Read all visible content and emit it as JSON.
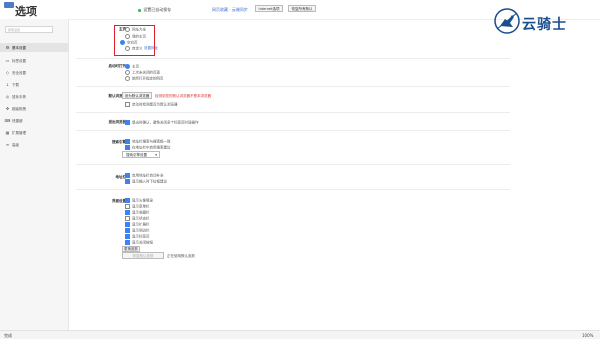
{
  "window": {
    "title": "选项"
  },
  "top": {
    "autosave": "设置已自动保存",
    "notify_link": "网页收藏 · 云端同步",
    "ie_button": "Internet选项",
    "restore_button": "恢复所有默认"
  },
  "sidebar": {
    "search_placeholder": "搜索设置",
    "items": [
      {
        "label": "基本设置",
        "icon": "gear-icon"
      },
      {
        "label": "标签设置",
        "icon": "tab-icon"
      },
      {
        "label": "安全设置",
        "icon": "shield-icon"
      },
      {
        "label": "下载",
        "icon": "download-icon"
      },
      {
        "label": "鼠标手势",
        "icon": "mouse-icon"
      },
      {
        "label": "超级拖拽",
        "icon": "drag-icon"
      },
      {
        "label": "快捷键",
        "icon": "keyboard-icon"
      },
      {
        "label": "扩展管理",
        "icon": "extension-icon"
      },
      {
        "label": "高级",
        "icon": "advanced-icon"
      }
    ]
  },
  "homepage": {
    "label": "主页",
    "options": [
      "网址大全",
      "我的主页",
      "空白页",
      "自定义"
    ],
    "selected": 2,
    "link": "设置网址"
  },
  "startup": {
    "label": "启动时打开",
    "options": [
      "主页",
      "上次未关闭的页面",
      "始终打开指定的网页"
    ],
    "selected": 0
  },
  "default_browser": {
    "label": "默认浏览器",
    "button": "设为默认浏览器",
    "warning": "检测到您的默认浏览器不是本浏览器",
    "check": "启动时检测是否为默认浏览器"
  },
  "session": {
    "label": "退出浏览器",
    "check": "退出时确认，避免关闭多个标签页时误操作"
  },
  "search_engine": {
    "label": "搜索引擎",
    "checks": [
      "地址栏搜索与搜索框一致",
      "在地址栏中启用搜索建议"
    ],
    "select": "搜索引擎设置"
  },
  "address_bar": {
    "label": "地址栏",
    "checks": [
      "启用地址栏自动补全",
      "显示输入时下拉框建议"
    ]
  },
  "appearance": {
    "label": "界面设置",
    "checks": [
      "显示头像登录",
      "显示菜单栏",
      "显示收藏栏",
      "显示状态栏",
      "显示扩展栏",
      "显示侧边栏",
      "显示标签页",
      "显示关闭按钮"
    ],
    "checked": [
      true,
      false,
      true,
      false,
      true,
      true,
      true,
      true
    ],
    "button": "更换皮肤",
    "bottom_button": "恢复默认皮肤",
    "bottom_text": "正在使用默认皮肤"
  },
  "branding": {
    "text": "云骑士"
  },
  "status": {
    "left": "完成",
    "right": "100%"
  }
}
